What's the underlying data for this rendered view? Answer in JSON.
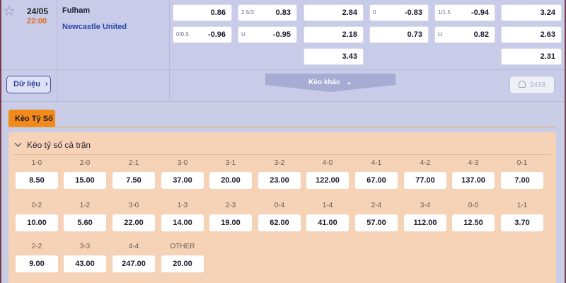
{
  "match": {
    "date": "24/05",
    "time": "22:00",
    "home": "Fulham",
    "away": "Newcastle United"
  },
  "odds": {
    "ft_1x2_home": "0.86",
    "ft_hdp_line": "2.5/3",
    "ft_hdp_home": "0.83",
    "ft_ou_over": "2.84",
    "h1_hdp_line0": "0",
    "h1_hdp_home": "-0.83",
    "h1_ou_line": "1/1.5",
    "h1_ou_over": "-0.94",
    "h1_1x2_home": "3.24",
    "r2_line": "0/0.5",
    "r2_val": "-0.96",
    "r2_u": "U",
    "r2_u_val": "-0.95",
    "r2_ou_under": "2.18",
    "r2_h1_hdp_away": "0.73",
    "r2_h1_u": "U",
    "r2_h1_u_val": "0.82",
    "r2_h1_draw": "2.63",
    "r3_draw": "3.43",
    "r3_h1_draw": "2.31"
  },
  "buttons": {
    "info_label": "Dữ liệu",
    "more_label": "Kèo khác",
    "count": "2438"
  },
  "section": {
    "tab_label": "Kèo Tỷ Số",
    "panel_title": "Kèo tỷ số cả trận"
  },
  "scores": [
    {
      "label": "1-0",
      "odd": "8.50"
    },
    {
      "label": "2-0",
      "odd": "15.00"
    },
    {
      "label": "2-1",
      "odd": "7.50"
    },
    {
      "label": "3-0",
      "odd": "37.00"
    },
    {
      "label": "3-1",
      "odd": "20.00"
    },
    {
      "label": "3-2",
      "odd": "23.00"
    },
    {
      "label": "4-0",
      "odd": "122.00"
    },
    {
      "label": "4-1",
      "odd": "67.00"
    },
    {
      "label": "4-2",
      "odd": "77.00"
    },
    {
      "label": "4-3",
      "odd": "137.00"
    },
    {
      "label": "0-1",
      "odd": "7.00"
    },
    {
      "label": "0-2",
      "odd": "10.00"
    },
    {
      "label": "1-2",
      "odd": "5.60"
    },
    {
      "label": "3-0",
      "odd": "22.00"
    },
    {
      "label": "1-3",
      "odd": "14.00"
    },
    {
      "label": "2-3",
      "odd": "19.00"
    },
    {
      "label": "0-4",
      "odd": "62.00"
    },
    {
      "label": "1-4",
      "odd": "41.00"
    },
    {
      "label": "2-4",
      "odd": "57.00"
    },
    {
      "label": "3-4",
      "odd": "112.00"
    },
    {
      "label": "0-0",
      "odd": "12.50"
    },
    {
      "label": "1-1",
      "odd": "3.70"
    },
    {
      "label": "2-2",
      "odd": "9.00"
    },
    {
      "label": "3-3",
      "odd": "43.00"
    },
    {
      "label": "4-4",
      "odd": "247.00"
    },
    {
      "label": "OTHER",
      "odd": "20.00"
    }
  ]
}
